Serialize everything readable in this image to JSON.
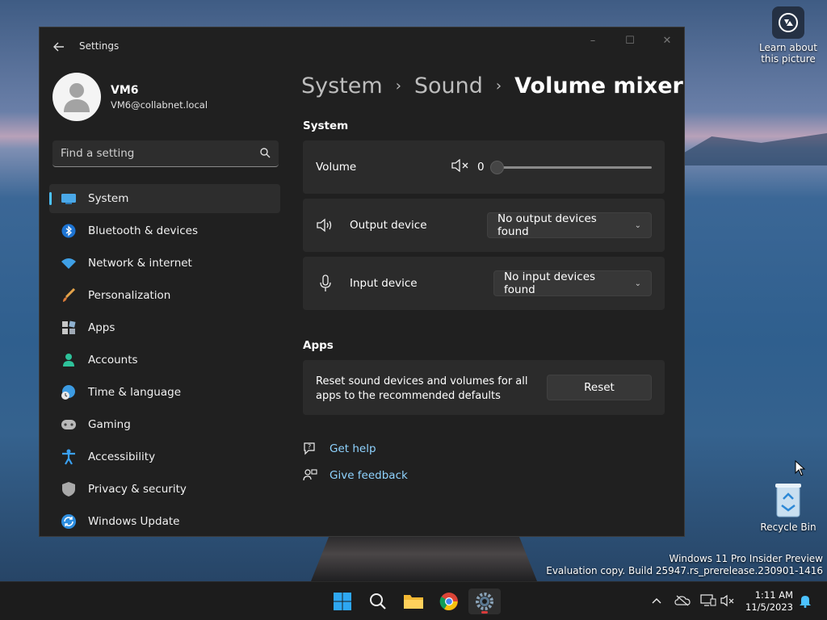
{
  "desktop": {
    "learn_label_1": "Learn about",
    "learn_label_2": "this picture",
    "recycle_label": "Recycle Bin",
    "watermark_line1": "Windows 11 Pro Insider Preview",
    "watermark_line2": "Evaluation copy. Build 25947.rs_prerelease.230901-1416"
  },
  "window": {
    "title": "Settings",
    "controls": {
      "minimize": "–",
      "maximize": "☐",
      "close": "✕"
    }
  },
  "profile": {
    "name": "VM6",
    "email": "VM6@collabnet.local"
  },
  "search": {
    "placeholder": "Find a setting"
  },
  "nav": [
    {
      "label": "System",
      "icon": "system-icon",
      "active": true
    },
    {
      "label": "Bluetooth & devices",
      "icon": "bluetooth-icon"
    },
    {
      "label": "Network & internet",
      "icon": "wifi-icon"
    },
    {
      "label": "Personalization",
      "icon": "brush-icon"
    },
    {
      "label": "Apps",
      "icon": "apps-icon"
    },
    {
      "label": "Accounts",
      "icon": "accounts-icon"
    },
    {
      "label": "Time & language",
      "icon": "globe-clock-icon"
    },
    {
      "label": "Gaming",
      "icon": "gamepad-icon"
    },
    {
      "label": "Accessibility",
      "icon": "accessibility-icon"
    },
    {
      "label": "Privacy & security",
      "icon": "shield-icon"
    },
    {
      "label": "Windows Update",
      "icon": "update-icon"
    }
  ],
  "breadcrumb": [
    "System",
    "Sound",
    "Volume mixer"
  ],
  "system_section": {
    "label": "System",
    "volume": {
      "label": "Volume",
      "value": "0"
    },
    "output": {
      "label": "Output device",
      "value": "No output devices found"
    },
    "input": {
      "label": "Input device",
      "value": "No input devices found"
    }
  },
  "apps_section": {
    "label": "Apps",
    "reset_text": "Reset sound devices and volumes for all apps to the recommended defaults",
    "reset_button": "Reset"
  },
  "links": {
    "help": "Get help",
    "feedback": "Give feedback"
  },
  "taskbar": {
    "time": "1:11 AM",
    "date": "11/5/2023",
    "apps": [
      "start-icon",
      "search-icon",
      "file-explorer-icon",
      "chrome-icon",
      "settings-icon"
    ]
  },
  "colors": {
    "accent": "#4cc2ff",
    "link": "#8fd3ff",
    "window_bg": "#202020",
    "card_bg": "#2b2b2b"
  }
}
